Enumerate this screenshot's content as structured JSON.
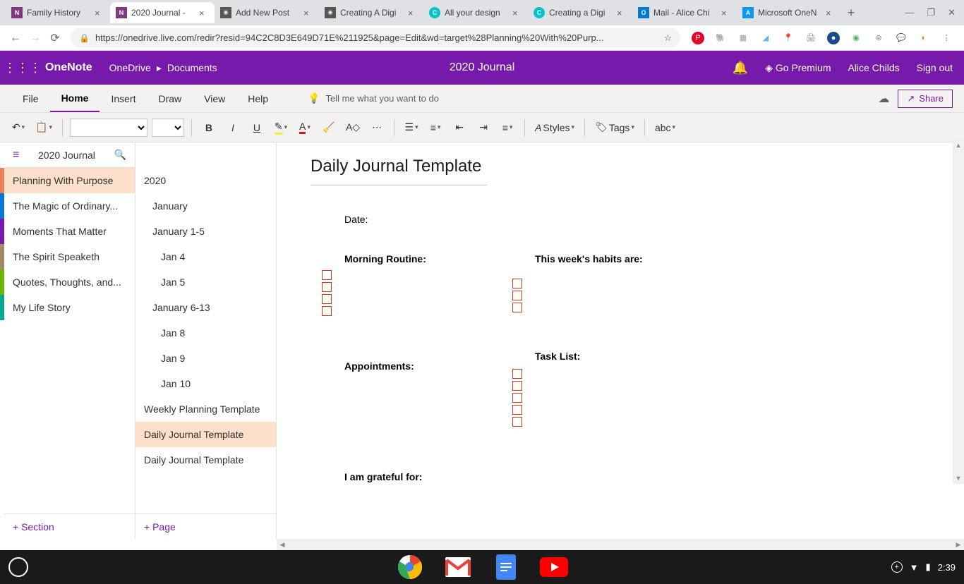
{
  "browser": {
    "tabs": [
      {
        "title": "Family History",
        "favicon_bg": "#80397b"
      },
      {
        "title": "2020 Journal -",
        "favicon_bg": "#80397b",
        "active": true
      },
      {
        "title": "Add New Post",
        "favicon_bg": "#777"
      },
      {
        "title": "Creating A Digi",
        "favicon_bg": "#777"
      },
      {
        "title": "All your design",
        "favicon_bg": "#00c4cc"
      },
      {
        "title": "Creating a Digi",
        "favicon_bg": "#00c4cc"
      },
      {
        "title": "Mail - Alice Chi",
        "favicon_bg": "#0078d4"
      },
      {
        "title": "Microsoft OneN",
        "favicon_bg": "#0d96f2"
      }
    ],
    "url": "https://onedrive.live.com/redir?resid=94C2C8D3E649D71E%211925&page=Edit&wd=target%28Planning%20With%20Purp..."
  },
  "onenote": {
    "brand": "OneNote",
    "breadcrumb_1": "OneDrive",
    "breadcrumb_2": "Documents",
    "doc_title": "2020 Journal",
    "go_premium": "Go Premium",
    "user": "Alice Childs",
    "signout": "Sign out"
  },
  "ribbon": {
    "file": "File",
    "home": "Home",
    "insert": "Insert",
    "draw": "Draw",
    "view": "View",
    "help": "Help",
    "tell_me": "Tell me what you want to do",
    "share": "Share",
    "styles": "Styles",
    "tags": "Tags"
  },
  "sidebar": {
    "notebook": "2020 Journal",
    "sections": [
      "Planning With Purpose",
      "The Magic of Ordinary...",
      "Moments That Matter",
      "The Spirit Speaketh",
      "Quotes, Thoughts, and...",
      "My Life Story"
    ],
    "add_section": "+ Section",
    "pages": [
      {
        "title": "2020",
        "indent": 0
      },
      {
        "title": "January",
        "indent": 1
      },
      {
        "title": "January 1-5",
        "indent": 1
      },
      {
        "title": "Jan 4",
        "indent": 2
      },
      {
        "title": "Jan 5",
        "indent": 2
      },
      {
        "title": "January 6-13",
        "indent": 1
      },
      {
        "title": "Jan 8",
        "indent": 2
      },
      {
        "title": "Jan 9",
        "indent": 2
      },
      {
        "title": "Jan 10",
        "indent": 2
      },
      {
        "title": "Weekly Planning Template",
        "indent": 0
      },
      {
        "title": "Daily Journal Template",
        "indent": 0,
        "active": true
      },
      {
        "title": "Daily Journal Template",
        "indent": 0
      }
    ],
    "add_page": "+ Page"
  },
  "canvas": {
    "page_title": "Daily Journal Template",
    "date_label": "Date:",
    "morning": "Morning  Routine:",
    "habits": "This week's habits are:",
    "appointments": "Appointments:",
    "tasklist": "Task List:",
    "grateful": "I am grateful for:"
  },
  "taskbar": {
    "time": "2:39"
  }
}
